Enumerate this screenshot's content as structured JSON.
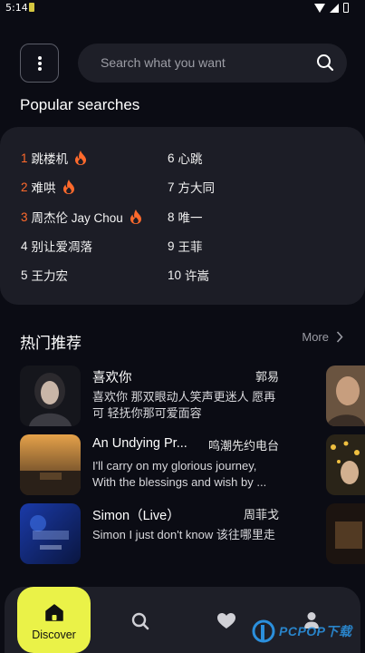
{
  "status_bar": {
    "time": "5:14"
  },
  "search": {
    "placeholder": "Search what you want"
  },
  "popular": {
    "title": "Popular searches",
    "items": [
      {
        "rank": "1",
        "name": "跳楼机",
        "hot": true
      },
      {
        "rank": "6",
        "name": "心跳",
        "hot": false
      },
      {
        "rank": "2",
        "name": "难哄",
        "hot": true
      },
      {
        "rank": "7",
        "name": "方大同",
        "hot": false
      },
      {
        "rank": "3",
        "name": "周杰伦 Jay Chou",
        "hot": true
      },
      {
        "rank": "8",
        "name": "唯一",
        "hot": false
      },
      {
        "rank": "4",
        "name": "别让爱凋落",
        "hot": false
      },
      {
        "rank": "9",
        "name": "王菲",
        "hot": false
      },
      {
        "rank": "5",
        "name": "王力宏",
        "hot": false
      },
      {
        "rank": "10",
        "name": "许嵩",
        "hot": false
      }
    ]
  },
  "hot": {
    "title": "热门推荐",
    "more_label": "More",
    "songs": [
      {
        "title": "喜欢你",
        "artist": "郭易",
        "desc": "喜欢你 那双眼动人笑声更迷人 愿再可 轻抚你那可爱面容"
      },
      {
        "title": "An Undying Pr...",
        "artist": "鸣潮先约电台",
        "desc": "I'll carry on my glorious journey, With the blessings and wish by ..."
      },
      {
        "title": "Simon（Live）",
        "artist": "周菲戈",
        "desc": "Simon I just don't know 该往哪里走"
      }
    ]
  },
  "nav": {
    "discover_label": "Discover",
    "items": [
      "search-icon",
      "heart-icon",
      "profile-icon"
    ]
  },
  "watermark": {
    "text": "PCPOP下载"
  },
  "colors": {
    "accent": "#eaf248",
    "hot_rank": "#ff6a2c",
    "background": "#0b0c14",
    "card": "#1c1d26"
  }
}
